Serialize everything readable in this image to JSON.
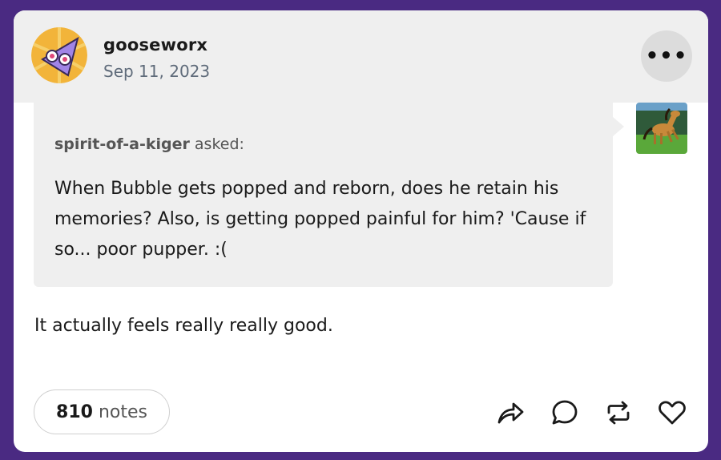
{
  "post": {
    "username": "gooseworx",
    "date": "Sep 11, 2023",
    "more_label": "•••",
    "ask": {
      "asker": "spirit-of-a-kiger",
      "asked_label": "asked:",
      "question": "When Bubble gets popped and reborn, does he retain his memories? Also, is getting popped painful for him? 'Cause if so... poor pupper. :("
    },
    "answer": "It actually feels really really good.",
    "notes": {
      "count": "810",
      "label": "notes"
    },
    "actions": [
      {
        "icon": "share-icon"
      },
      {
        "icon": "reply-icon"
      },
      {
        "icon": "reblog-icon"
      },
      {
        "icon": "like-icon"
      }
    ]
  },
  "colors": {
    "page_background": "#4a2a82",
    "header_background": "#efefef",
    "ask_background": "#efefef"
  }
}
